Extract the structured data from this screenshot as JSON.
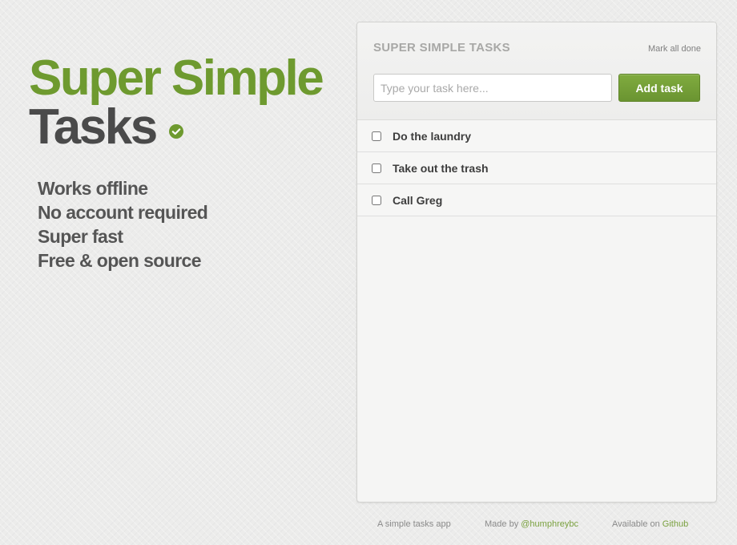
{
  "hero": {
    "title_line1": "Super Simple",
    "title_line2": "Tasks",
    "check_icon": "check-circle-icon",
    "features": [
      "Works offline",
      "No account required",
      "Super fast",
      "Free & open source"
    ]
  },
  "panel": {
    "title": "SUPER SIMPLE TASKS",
    "mark_all_label": "Mark all done",
    "input_placeholder": "Type your task here...",
    "input_value": "",
    "add_button_label": "Add task",
    "tasks": [
      {
        "label": "Do the laundry",
        "done": false
      },
      {
        "label": "Take out the trash",
        "done": false
      },
      {
        "label": "Call Greg",
        "done": false
      }
    ]
  },
  "footer": {
    "tagline": "A simple tasks app",
    "made_by_prefix": "Made by",
    "author_link": "@humphreybc",
    "available_prefix": "Available on",
    "github_link": "Github"
  },
  "colors": {
    "brand_green": "#6e9a2f",
    "title_dark": "#4a4a4a",
    "button_green": "#74a037",
    "link_green": "#7aa13f"
  }
}
